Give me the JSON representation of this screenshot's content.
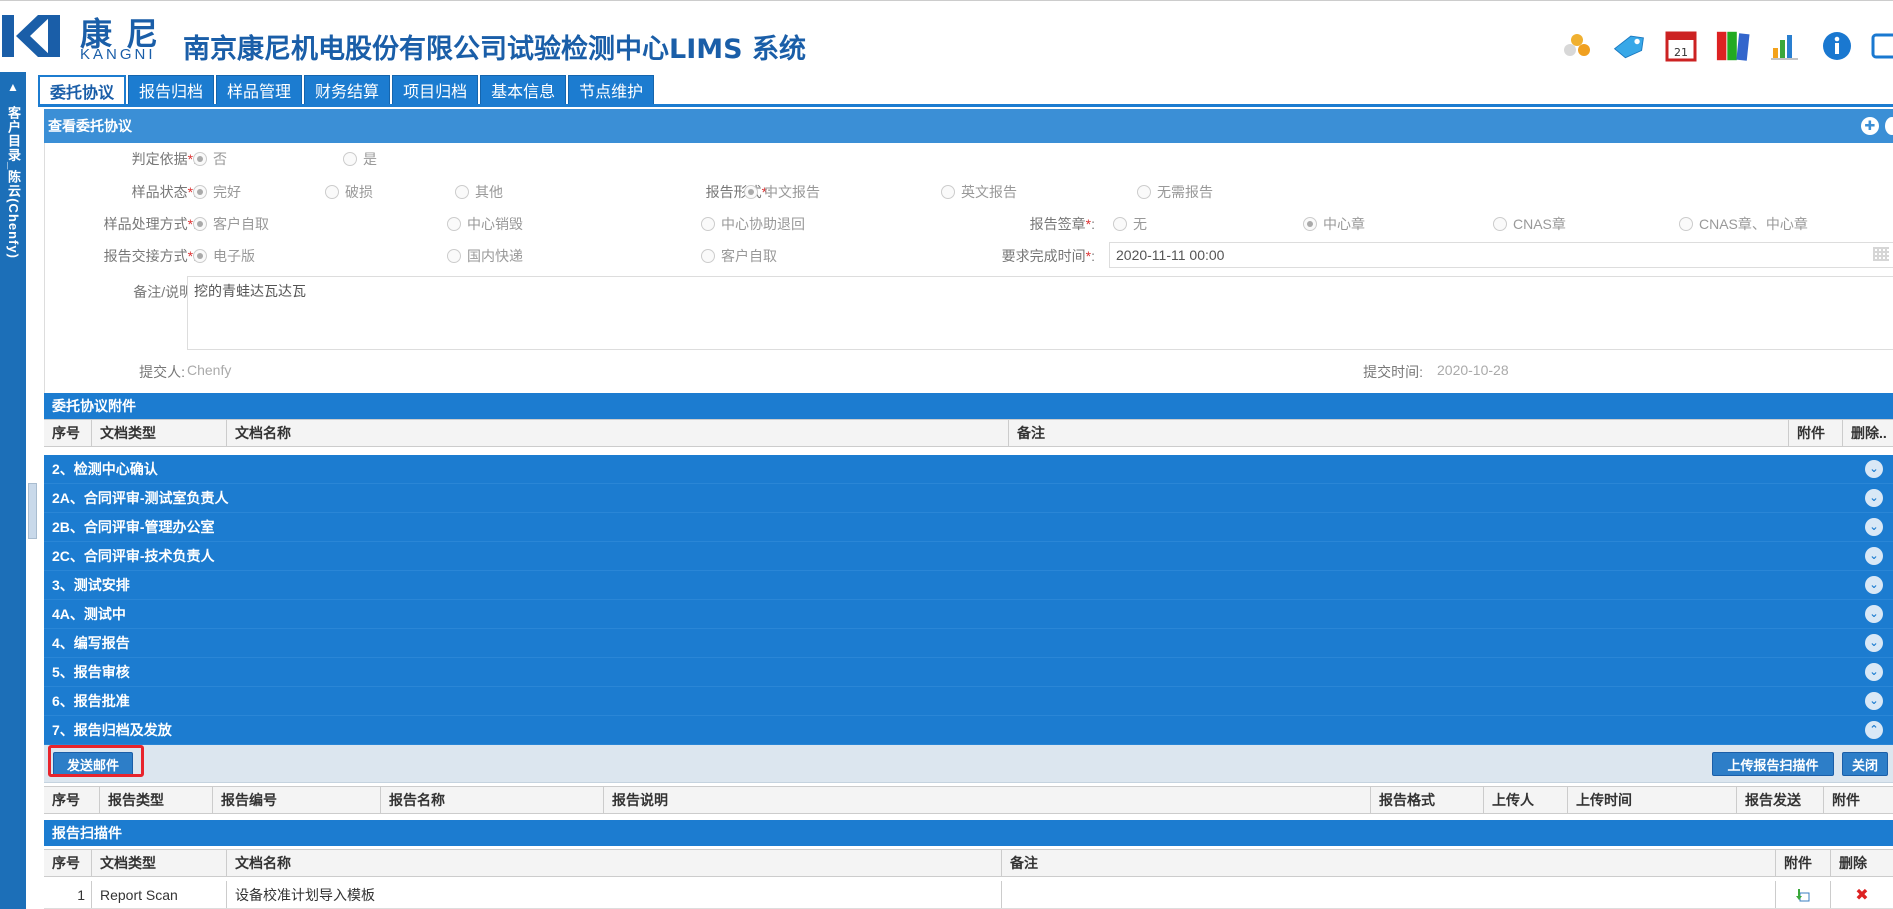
{
  "header": {
    "logo_cn": "康尼",
    "logo_en": "KANGNI",
    "title": "南京康尼机电股份有限公司试验检测中心LIMS 系统",
    "icons": [
      "users-icon",
      "tag-icon",
      "calendar-icon",
      "books-icon",
      "chart-icon",
      "info-icon",
      "window-icon"
    ],
    "calendar_day": "21"
  },
  "sidebar": {
    "label": "客户目录_陈云(Chenfy)"
  },
  "tabs": [
    {
      "label": "委托协议",
      "active": true
    },
    {
      "label": "报告归档"
    },
    {
      "label": "样品管理"
    },
    {
      "label": "财务结算"
    },
    {
      "label": "项目归档"
    },
    {
      "label": "基本信息"
    },
    {
      "label": "节点维护"
    }
  ],
  "panel": {
    "title": "查看委托协议"
  },
  "form": {
    "judgement_basis": {
      "label": "判定依据",
      "options": [
        "否",
        "是"
      ],
      "selected": "否"
    },
    "sample_state": {
      "label": "样品状态",
      "options": [
        "完好",
        "破损",
        "其他"
      ],
      "selected": "完好"
    },
    "report_form": {
      "label": "报告形式",
      "options": [
        "中文报告",
        "英文报告",
        "无需报告"
      ],
      "selected": "中文报告"
    },
    "sample_handling": {
      "label": "样品处理方式",
      "options": [
        "客户自取",
        "中心销毁",
        "中心协助退回"
      ],
      "selected": "客户自取"
    },
    "report_seal": {
      "label": "报告签章",
      "options": [
        "无",
        "中心章",
        "CNAS章",
        "CNAS章、中心章"
      ],
      "selected": "中心章"
    },
    "report_delivery": {
      "label": "报告交接方式",
      "options": [
        "电子版",
        "国内快递",
        "客户自取"
      ],
      "selected": "电子版"
    },
    "deadline": {
      "label": "要求完成时间",
      "value": "2020-11-11 00:00"
    },
    "remark": {
      "label": "备注/说明",
      "value": "挖的青蛙达瓦达瓦"
    },
    "submitter": {
      "label": "提交人:",
      "value": "Chenfy"
    },
    "submit_time": {
      "label": "提交时间:",
      "value": "2020-10-28"
    },
    "required_mark": "*",
    "colon": ":"
  },
  "attachments": {
    "title": "委托协议附件",
    "columns": [
      "序号",
      "文档类型",
      "文档名称",
      "备注",
      "附件",
      "删除.."
    ]
  },
  "workflow_steps": [
    "2、检测中心确认",
    "2A、合同评审-测试室负责人",
    "2B、合同评审-管理办公室",
    "2C、合同评审-技术负责人",
    "3、测试安排",
    "4A、测试中",
    "4、编写报告",
    "5、报告审核",
    "6、报告批准",
    "7、报告归档及发放"
  ],
  "toolbar": {
    "send_mail": "发送邮件",
    "upload_scan": "上传报告扫描件",
    "close": "关闭"
  },
  "report_grid": {
    "columns": [
      "序号",
      "报告类型",
      "报告编号",
      "报告名称",
      "报告说明",
      "报告格式",
      "上传人",
      "上传时间",
      "报告发送",
      "附件"
    ]
  },
  "scan_section": {
    "title": "报告扫描件",
    "columns": [
      "序号",
      "文档类型",
      "文档名称",
      "备注",
      "附件",
      "删除"
    ],
    "rows": [
      {
        "index": "1",
        "doc_type": "Report Scan",
        "doc_name": "设备校准计划导入模板",
        "remark": ""
      }
    ]
  }
}
